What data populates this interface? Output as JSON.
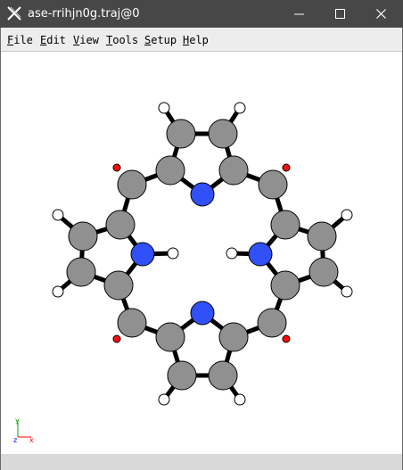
{
  "window": {
    "title": "ase-rrihjn0g.traj@0",
    "controls": [
      "minimize-icon",
      "maximize-icon",
      "close-icon"
    ]
  },
  "menu": {
    "items": [
      {
        "first": "F",
        "rest": "ile"
      },
      {
        "first": "E",
        "rest": "dit"
      },
      {
        "first": "V",
        "rest": "iew"
      },
      {
        "first": "T",
        "rest": "ools"
      },
      {
        "first": "S",
        "rest": "etup"
      },
      {
        "first": "H",
        "rest": "elp"
      }
    ]
  },
  "axes": {
    "y": "y",
    "z": "z",
    "x": "x",
    "colors": {
      "x": "#ff0000",
      "y": "#00a000",
      "z": "#0000ff"
    }
  },
  "colors": {
    "carbon": "#909090",
    "nitrogen": "#3050f8",
    "hydrogen": "#ffffff",
    "oxygen": "#ff0d0d",
    "bond": "#000000"
  }
}
